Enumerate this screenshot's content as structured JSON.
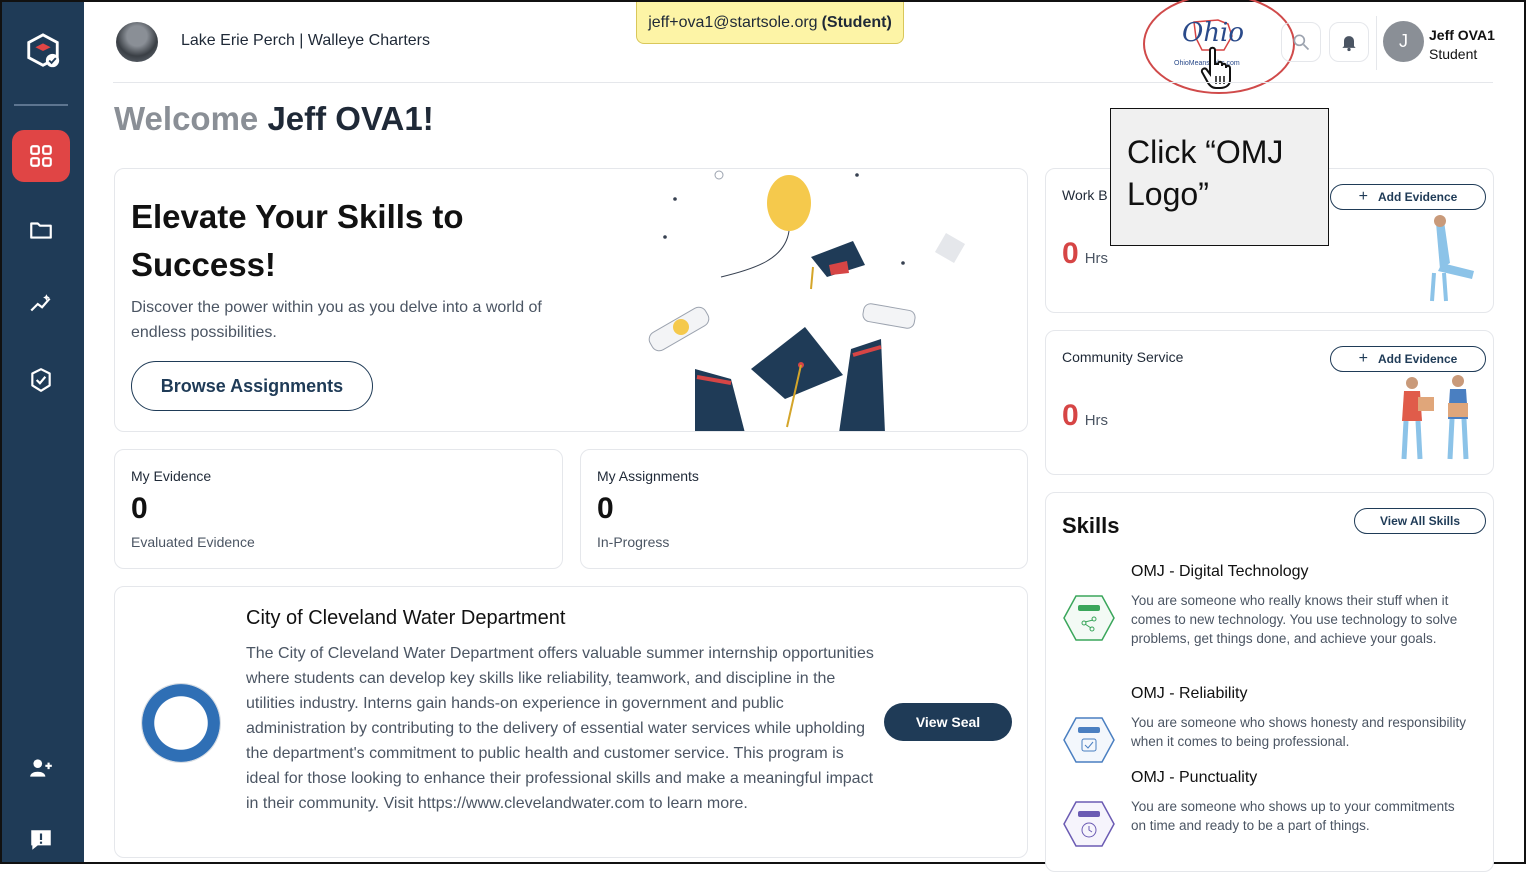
{
  "header": {
    "org_name": "Lake Erie Perch | Walleye Charters",
    "student_email": "jeff+ova1@startsole.org",
    "student_role": "(Student)",
    "logo_text": "Ohio",
    "logo_sub": "OhioMeansJobs.com",
    "user_initial": "J",
    "user_name": "Jeff OVA1",
    "user_role": "Student"
  },
  "welcome": {
    "prefix": "Welcome",
    "name": "Jeff OVA1!"
  },
  "hero": {
    "title": "Elevate Your Skills to Success!",
    "description": "Discover the power within you as you delve into a world of endless possibilities.",
    "button": "Browse Assignments"
  },
  "stats": [
    {
      "label": "My Evidence",
      "value": "0",
      "sub": "Evaluated Evidence"
    },
    {
      "label": "My Assignments",
      "value": "0",
      "sub": "In-Progress"
    }
  ],
  "job": {
    "title": "City of Cleveland Water Department",
    "description": "The City of Cleveland Water Department offers valuable summer internship opportunities where students can develop key skills like reliability, teamwork, and discipline in the utilities industry. Interns gain hands-on experience in government and public administration by contributing to the delivery of essential water services while upholding the department's commitment to public health and customer service. This program is ideal for those looking to enhance their professional skills and make a meaningful impact in their community. Visit https://www.clevelandwater.com to learn more.",
    "button": "View Seal"
  },
  "work_based": {
    "label": "Work B",
    "value": "0",
    "unit": "Hrs",
    "button": "Add Evidence"
  },
  "community": {
    "label": "Community Service",
    "value": "0",
    "unit": "Hrs",
    "button": "Add Evidence"
  },
  "skills": {
    "title": "Skills",
    "button": "View All Skills",
    "items": [
      {
        "title": "OMJ - Digital Technology",
        "description": "You are someone who really knows their stuff when it comes to new technology. You use technology to solve problems, get things done, and achieve your goals.",
        "color": "#3aa65b"
      },
      {
        "title": "OMJ - Reliability",
        "description": "You are someone who shows honesty and responsibility when it comes to being professional.",
        "color": "#4a7fc1"
      },
      {
        "title": "OMJ - Punctuality",
        "description": "You are someone who shows up to your commitments on time and ready to be a part of things.",
        "color": "#6b5bb3"
      }
    ]
  },
  "callout": {
    "line1": "Click “OMJ",
    "line2": "Logo”"
  },
  "colors": {
    "sidebar": "#1f3b57",
    "active": "#e04545",
    "hours": "#d64545",
    "banner": "#fdf4a6"
  }
}
